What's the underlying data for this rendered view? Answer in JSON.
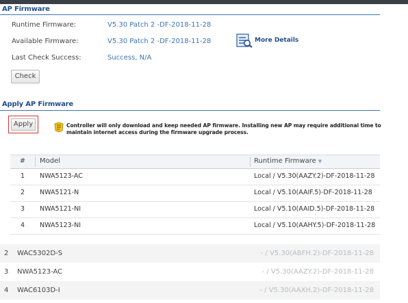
{
  "ap_firmware": {
    "title": "AP Firmware",
    "runtime_label": "Runtime Firmware:",
    "runtime_value": "V5.30 Patch 2 -DF-2018-11-28",
    "available_label": "Available Firmware:",
    "available_value": "V5.30 Patch 2 -DF-2018-11-28",
    "last_check_label": "Last Check Success:",
    "last_check_value": "Success, N/A",
    "check_button": "Check",
    "more_details": "More Details"
  },
  "apply_ap_firmware": {
    "title": "Apply AP Firmware",
    "apply_button": "Apply",
    "notice": "Controller will only download and keep needed AP firmware. Installing new AP may require additional time to maintain internet access during the firmware upgrade process."
  },
  "table": {
    "headers": {
      "num": "#",
      "model": "Model",
      "runtime": "Runtime Firmware"
    },
    "rows": [
      {
        "num": "1",
        "model": "NWA5123-AC",
        "runtime": "Local / V5.30(AAZY.2)-DF-2018-11-28"
      },
      {
        "num": "2",
        "model": "NWA5121-N",
        "runtime": "Local / V5.10(AAIF.5)-DF-2018-11-28"
      },
      {
        "num": "3",
        "model": "NWA5121-NI",
        "runtime": "Local / V5.10(AAID.5)-DF-2018-11-28"
      },
      {
        "num": "4",
        "model": "NWA5123-NI",
        "runtime": "Local / V5.10(AAHY.5)-DF-2018-11-28"
      }
    ]
  },
  "ghost_rows": [
    {
      "num": "2",
      "model": "WAC5302D-S",
      "runtime": "- / V5.30(ABFH.2)-DF-2018-11-28"
    },
    {
      "num": "3",
      "model": "NWA5123-AC",
      "runtime": "- / V5.30(AAZY.2)-DF-2018-11-28"
    },
    {
      "num": "4",
      "model": "WAC6103D-I",
      "runtime": "- / V5.30(AAXH.2)-DF-2018-11-28"
    }
  ]
}
